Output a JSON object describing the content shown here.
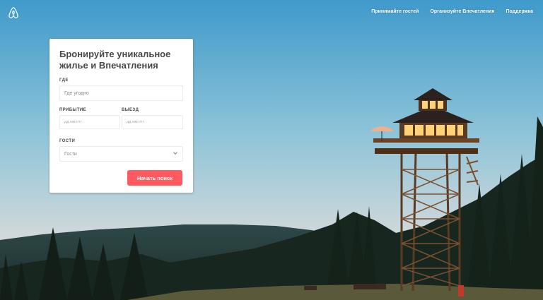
{
  "header": {
    "logo_icon": "airbnb-logo-icon",
    "nav": [
      {
        "label": "Принимайте гостей"
      },
      {
        "label": "Организуйте Впечатления"
      },
      {
        "label": "Поддержка"
      }
    ]
  },
  "search_card": {
    "title": "Бронируйте уникальное жилье и Впечатления",
    "where": {
      "label": "ГДЕ",
      "placeholder": "Где угодно"
    },
    "checkin": {
      "label": "ПРИБЫТИЕ",
      "placeholder": "дд.мм.гггг"
    },
    "checkout": {
      "label": "ВЫЕЗД",
      "placeholder": "дд.мм.гггг"
    },
    "guests": {
      "label": "ГОСТИ",
      "value": "Гости",
      "icon": "chevron-down-icon"
    },
    "search_button": "Начать поиск"
  },
  "colors": {
    "accent": "#ff5a5f",
    "sky_top": "#4a9fcb",
    "sky_bottom": "#d8dde0"
  }
}
